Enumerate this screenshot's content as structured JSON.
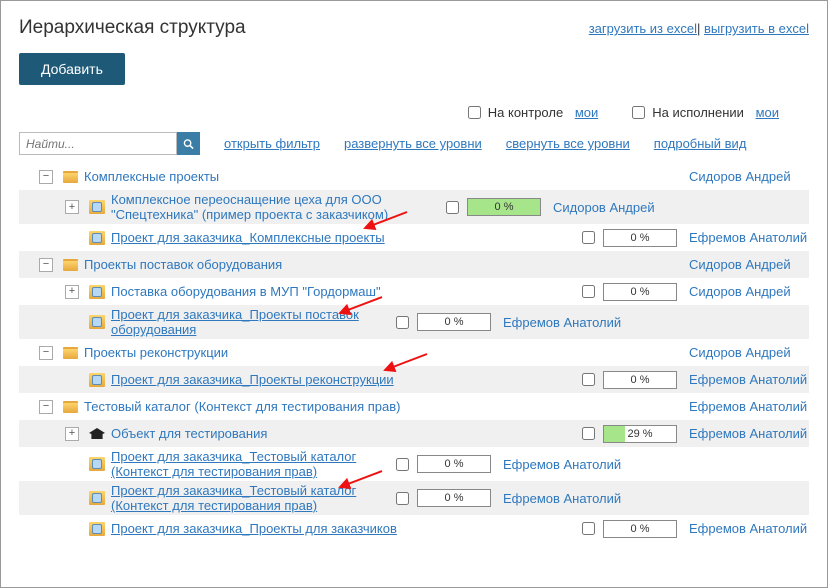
{
  "page_title": "Иерархическая структура",
  "links": {
    "import_excel": "загрузить из excel",
    "export_excel": "выгрузить в excel",
    "open_filter": "открыть фильтр",
    "expand_all": "развернуть все уровни",
    "collapse_all": "свернуть все уровни",
    "detailed_view": "подробный вид"
  },
  "buttons": {
    "add": "Добавить"
  },
  "filters": {
    "on_control_label": "На контроле",
    "on_execution_label": "На исполнении",
    "my": "мои"
  },
  "search": {
    "placeholder": "Найти..."
  },
  "owners": {
    "sidorov": "Сидоров Андрей",
    "efremov": "Ефремов Анатолий"
  },
  "tree": {
    "r1": "Комплексные проекты",
    "r2": "Комплексное переоснащение цеха для ООО \"Спецтехника\" (пример проекта с заказчиком)",
    "r3": "Проект для заказчика_Комплексные проекты",
    "r4": "Проекты поставок оборудования",
    "r5": "Поставка оборудования в МУП \"Гордормаш\"",
    "r6": "Проект для заказчика_Проекты поставок оборудования",
    "r7": "Проекты реконструкции",
    "r8": "Проект для заказчика_Проекты реконструкции",
    "r9": "Тестовый каталог (Контекст для тестирования прав)",
    "r10": "Объект для тестирования",
    "r11": "Проект для заказчика_Тестовый каталог (Контекст для тестирования прав)",
    "r12": "Проект для заказчика_Тестовый каталог (Контекст для тестирования прав)",
    "r13": "Проект для заказчика_Проекты для заказчиков"
  },
  "progress": {
    "p0": "0 %",
    "p29": "29 %"
  }
}
